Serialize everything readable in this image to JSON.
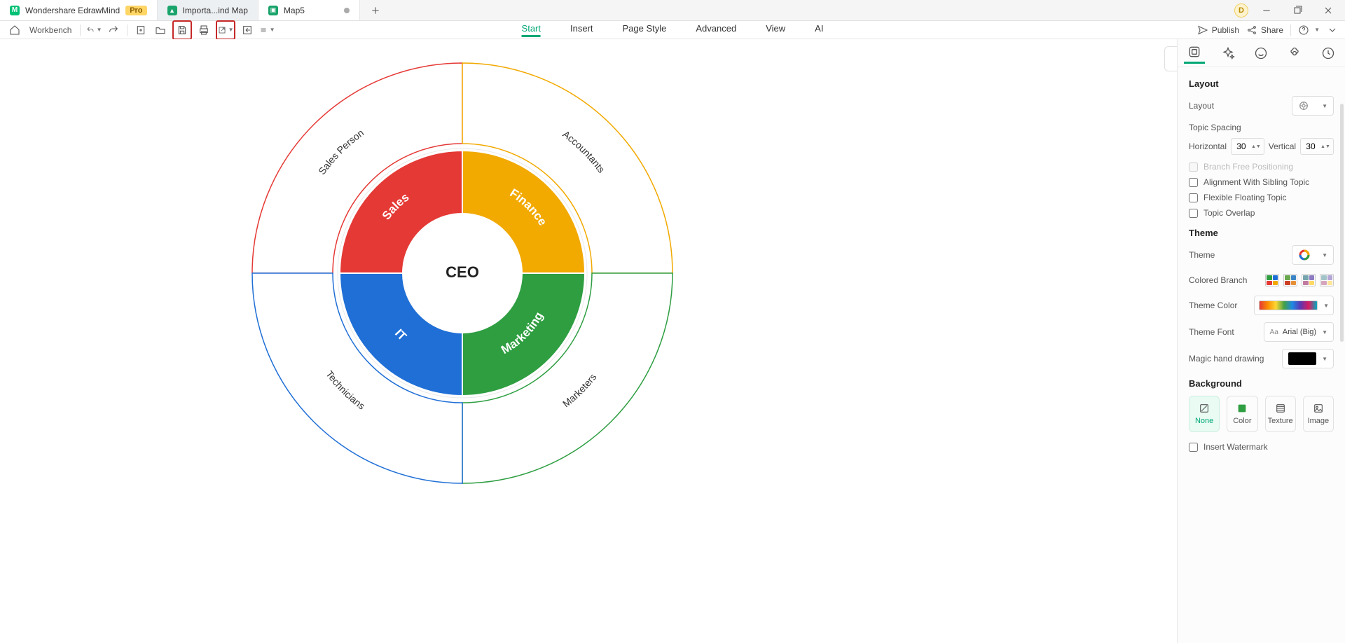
{
  "app": {
    "name": "Wondershare EdrawMind",
    "badge": "Pro",
    "avatar_initial": "D"
  },
  "tabs": [
    {
      "label": "Importa...ind Map",
      "active": false
    },
    {
      "label": "Map5",
      "active": true,
      "dirty": true
    }
  ],
  "toolbar": {
    "workbench": "Workbench",
    "menus": [
      "Start",
      "Insert",
      "Page Style",
      "Advanced",
      "View",
      "AI"
    ],
    "active_menu": "Start",
    "publish": "Publish",
    "share": "Share"
  },
  "chart_data": {
    "type": "sunburst",
    "center": "CEO",
    "inner": [
      {
        "name": "Sales",
        "angle_deg": 90,
        "color": "#e53935"
      },
      {
        "name": "Finance",
        "angle_deg": 90,
        "color": "#f2a900"
      },
      {
        "name": "Marketing",
        "angle_deg": 90,
        "color": "#2e9e41"
      },
      {
        "name": "IT",
        "angle_deg": 90,
        "color": "#1f6fd6"
      }
    ],
    "outer": [
      {
        "name": "Sales Person",
        "parent": "Sales",
        "outline": "#e53935"
      },
      {
        "name": "Accountants",
        "parent": "Finance",
        "outline": "#f2a900"
      },
      {
        "name": "Marketers",
        "parent": "Marketing",
        "outline": "#2e9e41"
      },
      {
        "name": "Technicians",
        "parent": "IT",
        "outline": "#1f6fd6"
      }
    ]
  },
  "panel": {
    "section_layout": "Layout",
    "layout_label": "Layout",
    "topic_spacing": "Topic Spacing",
    "horizontal": "Horizontal",
    "vertical": "Vertical",
    "h_val": "30",
    "v_val": "30",
    "chk_branch_free": "Branch Free Positioning",
    "chk_align_sibling": "Alignment With Sibling Topic",
    "chk_flex_float": "Flexible Floating Topic",
    "chk_overlap": "Topic Overlap",
    "section_theme": "Theme",
    "theme_label": "Theme",
    "colored_branch": "Colored Branch",
    "theme_color": "Theme Color",
    "theme_font": "Theme Font",
    "theme_font_val": "Arial (Big)",
    "magic_hand": "Magic hand drawing",
    "section_bg": "Background",
    "bg_none": "None",
    "bg_color": "Color",
    "bg_texture": "Texture",
    "bg_image": "Image",
    "insert_watermark": "Insert Watermark"
  }
}
